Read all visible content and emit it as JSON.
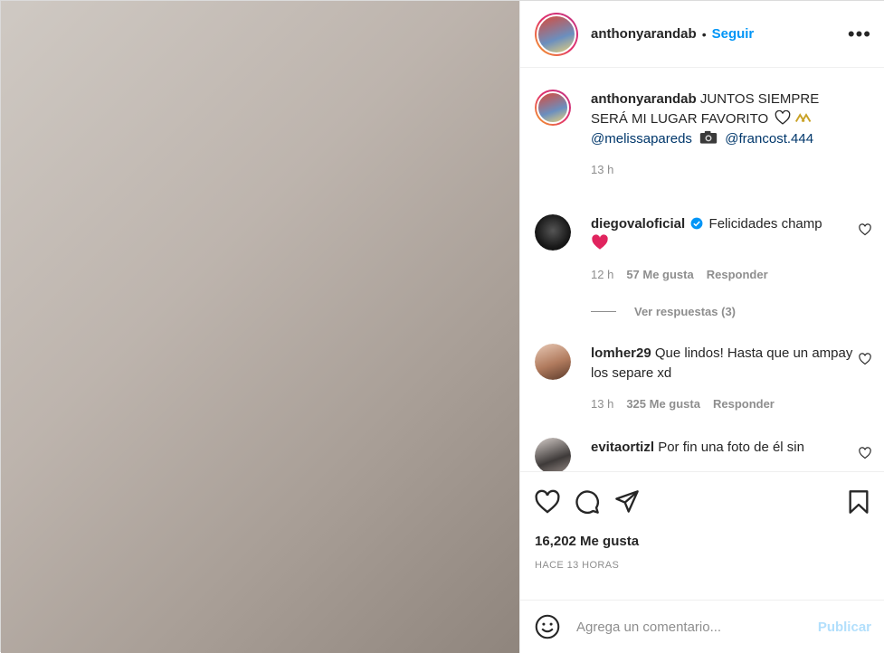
{
  "header": {
    "username": "anthonyarandab",
    "separator": "•",
    "follow_label": "Seguir",
    "more_label": "•••"
  },
  "caption": {
    "username": "anthonyarandab",
    "text": "JUNTOS SIEMPRE SERÁ MI LUGAR FAVORITO",
    "mention_1": "@melissapareds",
    "mention_2": "@francost.444",
    "time": "13 h"
  },
  "comments": [
    {
      "username": "diegovaloficial",
      "verified": true,
      "text": "Felicidades champ",
      "time": "12 h",
      "likes": "57 Me gusta",
      "reply_label": "Responder",
      "view_replies": "Ver respuestas (3)"
    },
    {
      "username": "lomher29",
      "text": "Que lindos! Hasta que un ampay los separe xd",
      "time": "13 h",
      "likes": "325 Me gusta",
      "reply_label": "Responder"
    },
    {
      "username": "evitaortizl",
      "text": "Por fin una foto de él sin"
    }
  ],
  "actions": {
    "likes_count": "16,202 Me gusta",
    "timestamp": "HACE 13 HORAS"
  },
  "add_comment": {
    "placeholder": "Agrega un comentario...",
    "publish_label": "Publicar"
  },
  "colors": {
    "link_blue": "#0095f6",
    "mention": "#00376b",
    "muted": "#8e8e8e",
    "publish_disabled": "#b2dffc",
    "heart_red": "#ed4956"
  }
}
